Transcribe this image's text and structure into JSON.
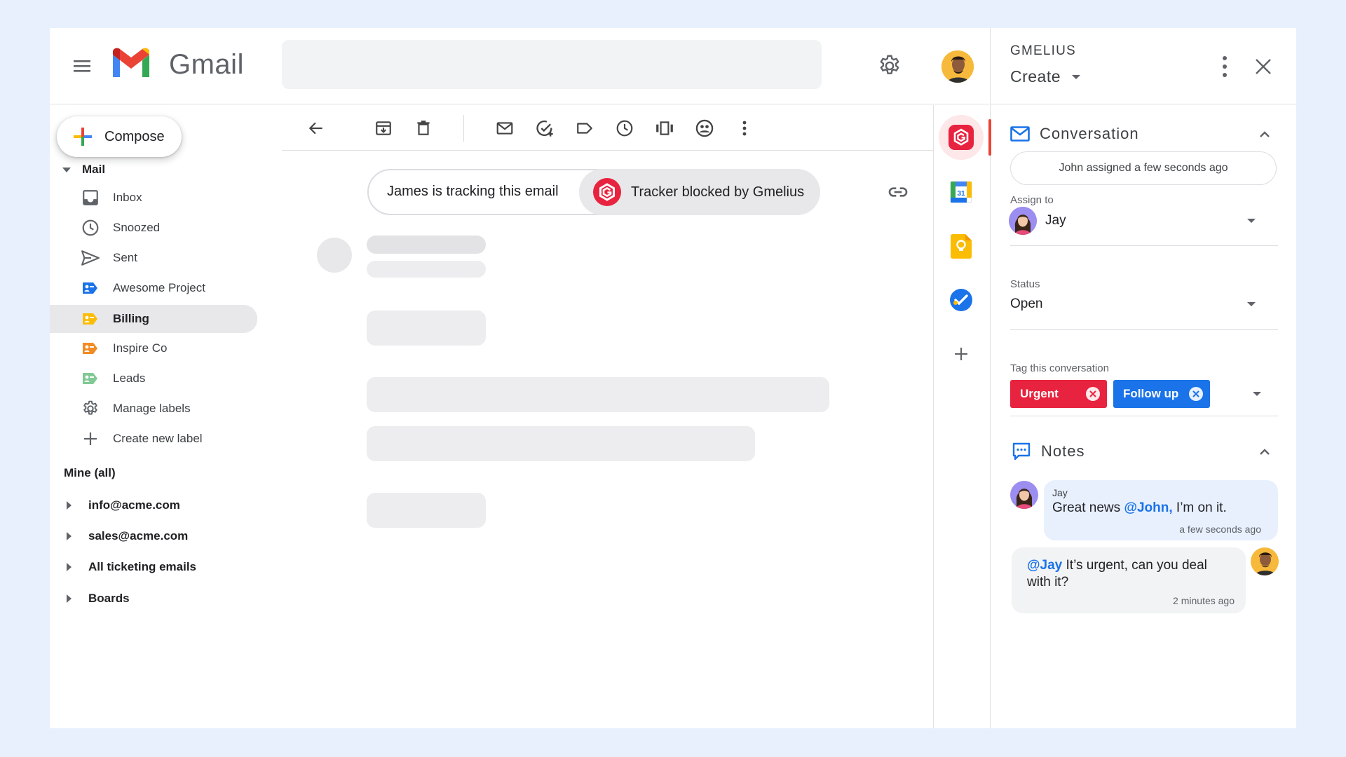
{
  "header": {
    "app_name": "Gmail",
    "avatar": "user-avatar-man"
  },
  "sidebar": {
    "compose_label": "Compose",
    "mail_section": "Mail",
    "items": [
      {
        "label": "Inbox",
        "icon": "inbox-icon"
      },
      {
        "label": "Snoozed",
        "icon": "clock-icon"
      },
      {
        "label": "Sent",
        "icon": "send-icon"
      },
      {
        "label": "Awesome Project",
        "icon": "label-icon",
        "color": "#1a73e8"
      },
      {
        "label": "Billing",
        "icon": "label-icon",
        "color": "#fbbc04",
        "active": true
      },
      {
        "label": "Inspire Co",
        "icon": "label-icon",
        "color": "#f28b24"
      },
      {
        "label": "Leads",
        "icon": "label-icon",
        "color": "#81c995"
      },
      {
        "label": "Manage labels",
        "icon": "gear-icon"
      },
      {
        "label": "Create new label",
        "icon": "plus-icon"
      }
    ],
    "mine_label": "Mine (all)",
    "accounts": [
      {
        "label": "info@acme.com"
      },
      {
        "label": "sales@acme.com"
      },
      {
        "label": "All ticketing emails"
      },
      {
        "label": "Boards"
      }
    ]
  },
  "toolbar": {
    "icons": [
      "back-arrow-icon",
      "archive-icon",
      "delete-icon",
      "mark-unread-icon",
      "add-task-icon",
      "label-icon",
      "snooze-icon",
      "move-icon",
      "share-icon",
      "more-vert-icon"
    ]
  },
  "tracker": {
    "tracking_text": "James is tracking this email",
    "blocked_text": "Tracker blocked by Gmelius"
  },
  "gmelius": {
    "brand": "GMELIUS",
    "mode": "Create",
    "conversation": {
      "title": "Conversation",
      "activity": "John assigned a few seconds ago",
      "assign_label": "Assign to",
      "assignee": "Jay",
      "status_label": "Status",
      "status_value": "Open",
      "tags_label": "Tag this conversation",
      "tags": [
        {
          "label": "Urgent",
          "color": "#e8233f"
        },
        {
          "label": "Follow up",
          "color": "#1a73e8"
        }
      ]
    },
    "notes": {
      "title": "Notes",
      "items": [
        {
          "author": "Jay",
          "pre": "Great news ",
          "mention": "@John,",
          "post": " I’m on it.",
          "time": "a few seconds ago"
        },
        {
          "mention": "@Jay",
          "post": " It’s urgent, can you deal with it?",
          "time": "2 minutes ago"
        }
      ]
    }
  },
  "colors": {
    "accent": "#1a73e8",
    "gmelius_red": "#e8233f",
    "page_bg": "#e8f0fd"
  }
}
